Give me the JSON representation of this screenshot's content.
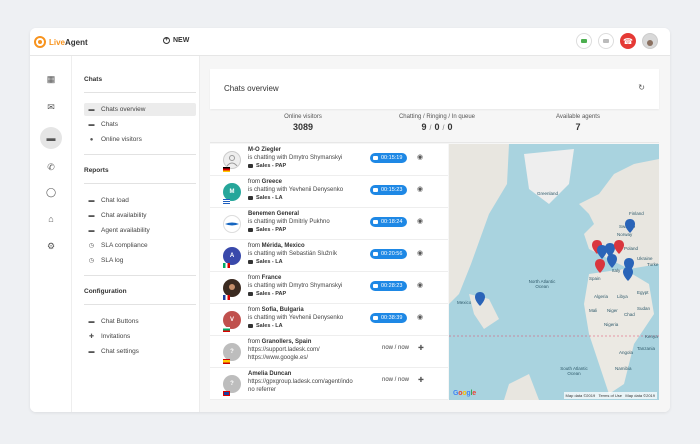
{
  "app": {
    "logo_live": "Live",
    "logo_agent": "Agent",
    "new_label": "NEW"
  },
  "colors": {
    "accent": "#1e88e5",
    "brand": "#f7931e",
    "danger": "#e53935",
    "online": "#4caf50"
  },
  "sidebar": {
    "chats_title": "Chats",
    "chats": [
      {
        "label": "Chats overview",
        "icon": "chat-bubble-icon"
      },
      {
        "label": "Chats",
        "icon": "chat-bubble-icon"
      },
      {
        "label": "Online visitors",
        "icon": "location-pin-icon"
      }
    ],
    "reports_title": "Reports",
    "reports": [
      {
        "label": "Chat load",
        "icon": "chat-bubble-icon"
      },
      {
        "label": "Chat availability",
        "icon": "chat-bubble-icon"
      },
      {
        "label": "Agent availability",
        "icon": "chat-bubble-icon"
      },
      {
        "label": "SLA compliance",
        "icon": "clock-icon"
      },
      {
        "label": "SLA log",
        "icon": "clock-icon"
      }
    ],
    "config_title": "Configuration",
    "config": [
      {
        "label": "Chat Buttons",
        "icon": "chat-bubble-icon"
      },
      {
        "label": "Invitations",
        "icon": "user-add-icon"
      },
      {
        "label": "Chat settings",
        "icon": "chat-bubble-icon"
      }
    ]
  },
  "overview": {
    "title": "Chats overview",
    "online_visitors_label": "Online visitors",
    "online_visitors": "3089",
    "crq_label": "Chatting / Ringing / In queue",
    "chatting": "9",
    "ringing": "0",
    "in_queue": "0",
    "slash": "/",
    "agents_label": "Available agents",
    "agents": "7"
  },
  "rows": [
    {
      "name": "M-O Ziegler",
      "line2": "is chatting with Dmytro Shymanskyi",
      "dept": "Sales - PAP",
      "timer": "00:15:19",
      "avatar": "",
      "avatar_color": "#d8d8d8",
      "flag": "de"
    },
    {
      "from": "from ",
      "name": "Greece",
      "line2": "is chatting with Yevhenii Denysenko",
      "dept": "Sales - LA",
      "timer": "00:15:23",
      "avatar": "M",
      "avatar_color": "#26a69a",
      "flag": "gr"
    },
    {
      "name": "Benemen General",
      "line2": "is chatting with Dmitriy Pukhno",
      "dept": "Sales - PAP",
      "timer": "00:18:24",
      "avatar": "",
      "avatar_color": "#ffffff",
      "flag": ""
    },
    {
      "from": "from ",
      "name": "Mérida, Mexico",
      "line2": "is chatting with Sebastián Služník",
      "dept": "Sales - LA",
      "timer": "00:20:56",
      "avatar": "A",
      "avatar_color": "#3949ab",
      "flag": "mx"
    },
    {
      "from": "from ",
      "name": "France",
      "line2": "is chatting with Dmytro Shymanskyi",
      "dept": "Sales - PAP",
      "timer": "00:28:23",
      "avatar": "",
      "avatar_color": "#3b2a20",
      "flag": "fr"
    },
    {
      "from": "from ",
      "name": "Sofia, Bulgaria",
      "line2": "is chatting with Yevhenii Denysenko",
      "dept": "Sales - LA",
      "timer": "00:38:39",
      "avatar": "V",
      "avatar_color": "#c0504d",
      "flag": "bg"
    },
    {
      "from": "from ",
      "name": "Granollers, Spain",
      "line2": "https://support.ladesk.com/",
      "line3": "https://www.google.es/",
      "status": "now / now",
      "avatar": "?",
      "avatar_color": "#bdbdbd",
      "flag": "es"
    },
    {
      "name": "Amelia Duncan",
      "line2": "https://gpxgroup.ladesk.com/agent/indo",
      "line3": "no referrer",
      "status": "now / now",
      "avatar": "?",
      "avatar_color": "#bdbdbd",
      "flag": "gb"
    }
  ],
  "map": {
    "labels": [
      "Greenland",
      "North Atlantic Ocean",
      "Mexico",
      "Norway",
      "Finland",
      "Sweden",
      "Poland",
      "Ukraine",
      "Italy",
      "Spain",
      "Algeria",
      "Libya",
      "Egypt",
      "Sudan",
      "Mali",
      "Niger",
      "Chad",
      "Nigeria",
      "Kenya",
      "Angola",
      "Namibia",
      "South Atlantic Ocean",
      "Tanzania",
      "Turke"
    ],
    "google": [
      "G",
      "o",
      "o",
      "g",
      "l",
      "e"
    ],
    "copyright_a": "Map data ©2019",
    "copyright_b": "Terms of Use",
    "copyright_c": "Map data ©2019"
  }
}
